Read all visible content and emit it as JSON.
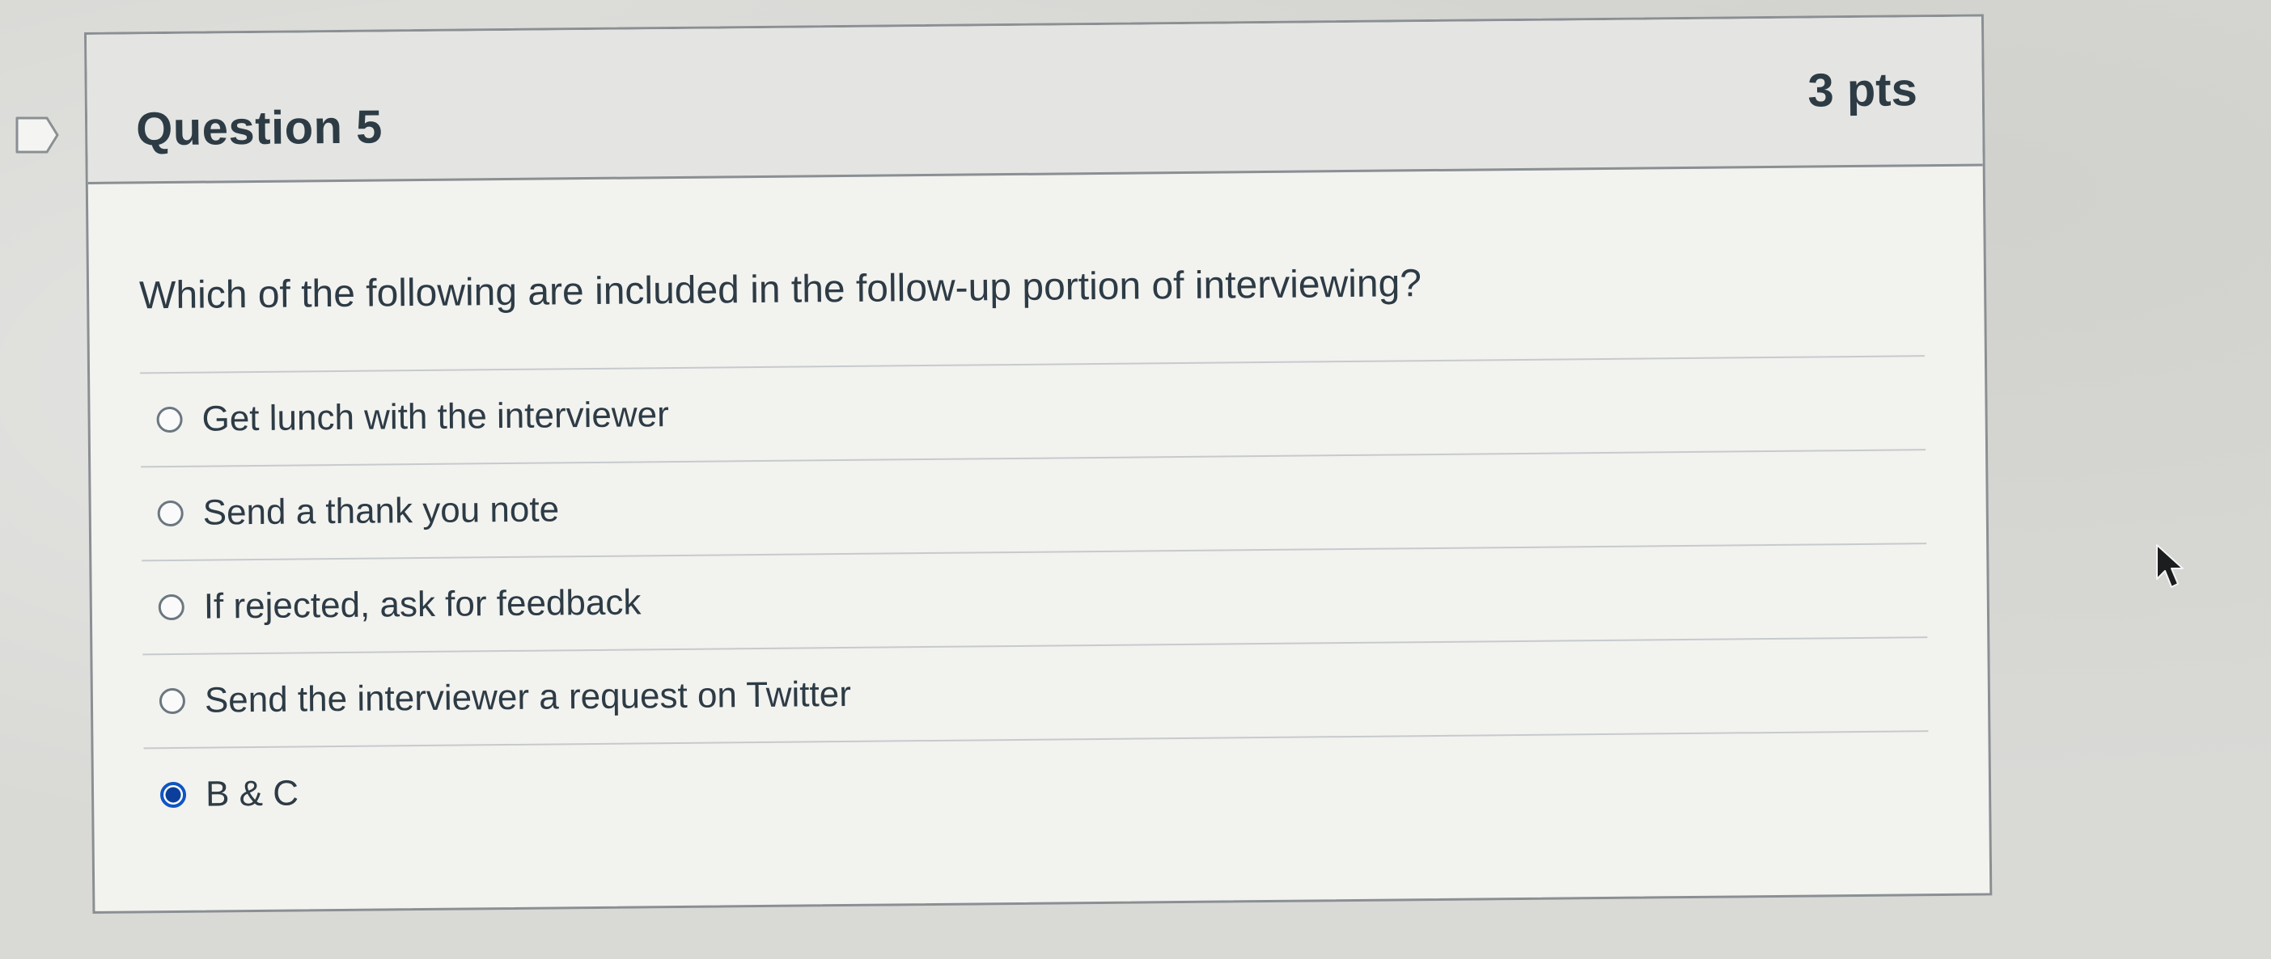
{
  "question": {
    "title": "Question 5",
    "points": "3 pts",
    "text": "Which of the following are included in the follow-up portion of interviewing?"
  },
  "answers": [
    {
      "label": "Get lunch with the interviewer",
      "selected": false
    },
    {
      "label": "Send a thank you note",
      "selected": false
    },
    {
      "label": "If rejected, ask for feedback",
      "selected": false
    },
    {
      "label": "Send the interviewer a request on Twitter",
      "selected": false
    },
    {
      "label": "B & C",
      "selected": true
    }
  ],
  "icons": {
    "flag": "flag-bookmark-icon",
    "cursor": "mouse-pointer-icon"
  },
  "colors": {
    "selected_radio": "#0f55c3",
    "text": "#2d3b45"
  }
}
